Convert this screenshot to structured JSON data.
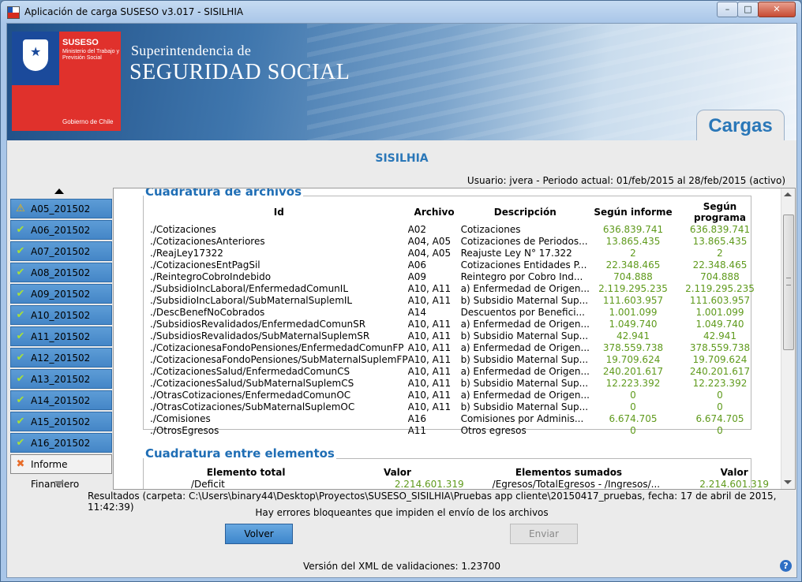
{
  "window": {
    "title": "Aplicación de carga SUSESO v3.017 - SISILHIA",
    "min_glyph": "–",
    "max_glyph": "□",
    "close_glyph": "✕"
  },
  "banner": {
    "logo_name": "SUSESO",
    "logo_sub": "Ministerio del Trabajo y Previsión Social",
    "logo_gob": "Gobierno de Chile",
    "superintendencia": "Superintendencia de",
    "seguridad": "SEGURIDAD SOCIAL",
    "tab": "Cargas"
  },
  "header": {
    "system_title": "SISILHIA",
    "usuario": "Usuario: jvera - Periodo actual: 01/feb/2015 al 28/feb/2015 (activo)"
  },
  "sidebar": {
    "items": [
      {
        "label": "A05_201502",
        "icon": "warning-icon"
      },
      {
        "label": "A06_201502",
        "icon": "check-icon"
      },
      {
        "label": "A07_201502",
        "icon": "check-icon"
      },
      {
        "label": "A08_201502",
        "icon": "check-icon"
      },
      {
        "label": "A09_201502",
        "icon": "check-icon"
      },
      {
        "label": "A10_201502",
        "icon": "check-icon"
      },
      {
        "label": "A11_201502",
        "icon": "check-icon"
      },
      {
        "label": "A12_201502",
        "icon": "check-icon"
      },
      {
        "label": "A13_201502",
        "icon": "check-icon"
      },
      {
        "label": "A14_201502",
        "icon": "check-icon"
      },
      {
        "label": "A15_201502",
        "icon": "check-icon"
      },
      {
        "label": "A16_201502",
        "icon": "check-icon"
      }
    ],
    "informe": {
      "label": "Informe Financiero",
      "icon": "error-x-icon"
    }
  },
  "cuadratura_archivos": {
    "title": "Cuadratura de archivos",
    "headers": [
      "Id",
      "Archivo",
      "Descripción",
      "Según informe",
      "Según programa"
    ],
    "rows": [
      [
        "./Cotizaciones",
        "A02",
        "Cotizaciones",
        "636.839.741",
        "636.839.741"
      ],
      [
        "./CotizacionesAnteriores",
        "A04, A05",
        "Cotizaciones de Periodos...",
        "13.865.435",
        "13.865.435"
      ],
      [
        "./ReajLey17322",
        "A04, A05",
        "Reajuste Ley N° 17.322",
        "2",
        "2"
      ],
      [
        "./CotizacionesEntPagSil",
        "A06",
        "Cotizaciones Entidades P...",
        "22.348.465",
        "22.348.465"
      ],
      [
        "./ReintegroCobroIndebido",
        "A09",
        "Reintegro por Cobro Ind...",
        "704.888",
        "704.888"
      ],
      [
        "./SubsidioIncLaboral/EnfermedadComunIL",
        "A10, A11",
        "a) Enfermedad de Origen...",
        "2.119.295.235",
        "2.119.295.235"
      ],
      [
        "./SubsidioIncLaboral/SubMaternalSuplemIL",
        "A10, A11",
        "b) Subsidio Maternal Sup...",
        "111.603.957",
        "111.603.957"
      ],
      [
        "./DescBenefNoCobrados",
        "A14",
        "Descuentos por Benefici...",
        "1.001.099",
        "1.001.099"
      ],
      [
        "./SubsidiosRevalidados/EnfermedadComunSR",
        "A10, A11",
        "a) Enfermedad de Origen...",
        "1.049.740",
        "1.049.740"
      ],
      [
        "./SubsidiosRevalidados/SubMaternalSuplemSR",
        "A10, A11",
        "b) Subsidio Maternal Sup...",
        "42.941",
        "42.941"
      ],
      [
        "./CotizacionesaFondoPensiones/EnfermedadComunFP",
        "A10, A11",
        "a) Enfermedad de Origen...",
        "378.559.738",
        "378.559.738"
      ],
      [
        "./CotizacionesaFondoPensiones/SubMaternalSuplemFP",
        "A10, A11",
        "b) Subsidio Maternal Sup...",
        "19.709.624",
        "19.709.624"
      ],
      [
        "./CotizacionesSalud/EnfermedadComunCS",
        "A10, A11",
        "a) Enfermedad de Origen...",
        "240.201.617",
        "240.201.617"
      ],
      [
        "./CotizacionesSalud/SubMaternalSuplemCS",
        "A10, A11",
        "b) Subsidio Maternal Sup...",
        "12.223.392",
        "12.223.392"
      ],
      [
        "./OtrasCotizaciones/EnfermedadComunOC",
        "A10, A11",
        "a) Enfermedad de Origen...",
        "0",
        "0"
      ],
      [
        "./OtrasCotizaciones/SubMaternalSuplemOC",
        "A10, A11",
        "b) Subsidio Maternal Sup...",
        "0",
        "0"
      ],
      [
        "./Comisiones",
        "A16",
        "Comisiones por Adminis...",
        "6.674.705",
        "6.674.705"
      ],
      [
        "./OtrosEgresos",
        "A11",
        "Otros egresos",
        "0",
        "0"
      ]
    ]
  },
  "cuadratura_elementos": {
    "title": "Cuadratura entre elementos",
    "headers": [
      "Elemento total",
      "Valor",
      "Elementos sumados",
      "Valor"
    ],
    "rows": [
      [
        "/Deficit",
        "2.214.601.319",
        "/Egresos/TotalEgresos - /Ingresos/...",
        "2.214.601.319"
      ]
    ]
  },
  "footer": {
    "resultados": "Resultados (carpeta: C:\\Users\\binary44\\Desktop\\Proyectos\\SUSESO_SISILHIA\\Pruebas app cliente\\20150417_pruebas, fecha: 17 de abril de 2015, 11:42:39)",
    "errores": "Hay errores bloqueantes que impiden el envío de los archivos",
    "volver": "Volver",
    "enviar": "Enviar",
    "version": "Versión del XML de validaciones: 1.23700",
    "help": "?"
  },
  "colors": {
    "accent": "#2a77b8",
    "sidebar_item": "#4a8bcb",
    "value_green": "#5f9a1c"
  }
}
